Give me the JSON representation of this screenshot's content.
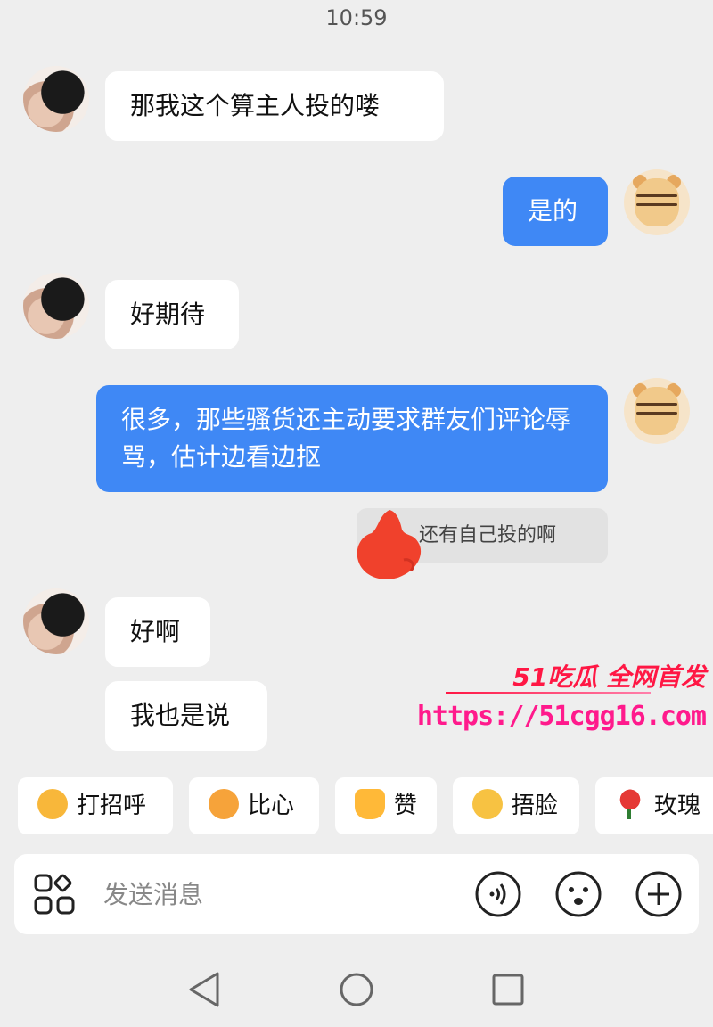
{
  "status": {
    "time": "10:59"
  },
  "messages": [
    {
      "from": "her",
      "text": "那我这个算主人投的喽"
    },
    {
      "from": "me",
      "text": "是的"
    },
    {
      "from": "her",
      "text": "好期待"
    },
    {
      "from": "me",
      "text": "很多，那些骚货还主动要求群友们评论辱骂，估计边看边抠"
    },
    {
      "from": "me",
      "reply_chip": "还有自己投的啊"
    },
    {
      "from": "her",
      "text": "好啊"
    },
    {
      "from": "her",
      "text": "我也是说"
    }
  ],
  "watermark": {
    "brand": "51吃瓜 全网首发",
    "url": "https://51cgg16.com"
  },
  "quick_replies": [
    {
      "label": "打招呼",
      "icon": "wave-emoji-icon"
    },
    {
      "label": "比心",
      "icon": "heart-hands-emoji-icon"
    },
    {
      "label": "赞",
      "icon": "thumbs-up-emoji-icon"
    },
    {
      "label": "捂脸",
      "icon": "facepalm-emoji-icon"
    },
    {
      "label": "玫瑰",
      "icon": "rose-emoji-icon"
    }
  ],
  "input": {
    "placeholder": "发送消息"
  },
  "colors": {
    "outgoing_bubble": "#3f88f5",
    "incoming_bubble": "#ffffff",
    "background": "#eeeeee",
    "watermark": "#ff1744"
  }
}
